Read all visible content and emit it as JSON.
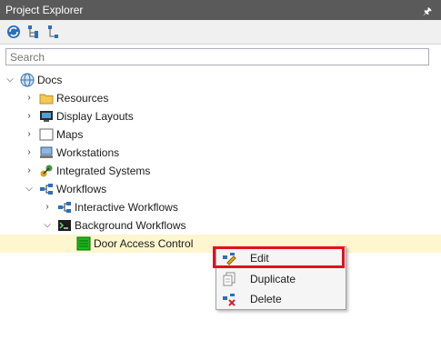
{
  "panel": {
    "title": "Project Explorer",
    "pin_icon": "pin-icon"
  },
  "toolbar": {
    "buttons": [
      {
        "icon": "sync-icon"
      },
      {
        "icon": "expand-tree-icon"
      },
      {
        "icon": "collapse-tree-icon"
      }
    ]
  },
  "search": {
    "placeholder": "Search"
  },
  "tree": {
    "root": {
      "label": "Docs",
      "icon": "globe-icon"
    },
    "items": {
      "resources": {
        "label": "Resources",
        "icon": "folder-icon"
      },
      "display_layouts": {
        "label": "Display Layouts",
        "icon": "display-layout-icon"
      },
      "maps": {
        "label": "Maps",
        "icon": "map-icon"
      },
      "workstations": {
        "label": "Workstations",
        "icon": "workstation-icon"
      },
      "integrated_systems": {
        "label": "Integrated Systems",
        "icon": "integrated-systems-icon"
      },
      "workflows": {
        "label": "Workflows",
        "icon": "workflow-icon"
      },
      "interactive_workflows": {
        "label": "Interactive Workflows",
        "icon": "workflow-icon"
      },
      "background_workflows": {
        "label": "Background Workflows",
        "icon": "console-icon"
      },
      "door_access_control": {
        "label": "Door Access Control",
        "icon": "green-workflow-icon"
      }
    }
  },
  "context_menu": {
    "items": [
      {
        "label": "Edit",
        "icon": "edit-icon"
      },
      {
        "label": "Duplicate",
        "icon": "duplicate-icon"
      },
      {
        "label": "Delete",
        "icon": "delete-icon"
      }
    ]
  },
  "colors": {
    "titlebar": "#5a5a5a",
    "selected_row": "#fdf6cf",
    "highlight": "#e3101e"
  }
}
